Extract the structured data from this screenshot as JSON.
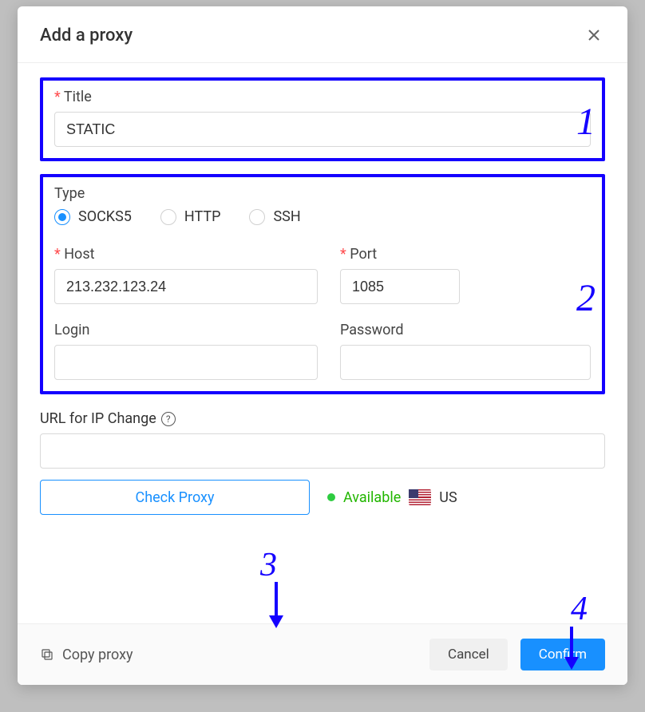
{
  "header": {
    "title": "Add a proxy"
  },
  "section1": {
    "title_label": "Title",
    "title_value": "STATIC",
    "annotation": "1"
  },
  "section2": {
    "type_label": "Type",
    "radios": {
      "socks5": "SOCKS5",
      "http": "HTTP",
      "ssh": "SSH",
      "selected": "socks5"
    },
    "host_label": "Host",
    "host_value": "213.232.123.24",
    "port_label": "Port",
    "port_value": "1085",
    "login_label": "Login",
    "login_value": "",
    "password_label": "Password",
    "password_value": "",
    "annotation": "2"
  },
  "url_change": {
    "label": "URL for IP Change",
    "value": ""
  },
  "annotation3": "3",
  "annotation4": "4",
  "check": {
    "button": "Check Proxy",
    "status_text": "Available",
    "country": "US"
  },
  "footer": {
    "copy": "Copy proxy",
    "cancel": "Cancel",
    "confirm": "Confirm"
  }
}
